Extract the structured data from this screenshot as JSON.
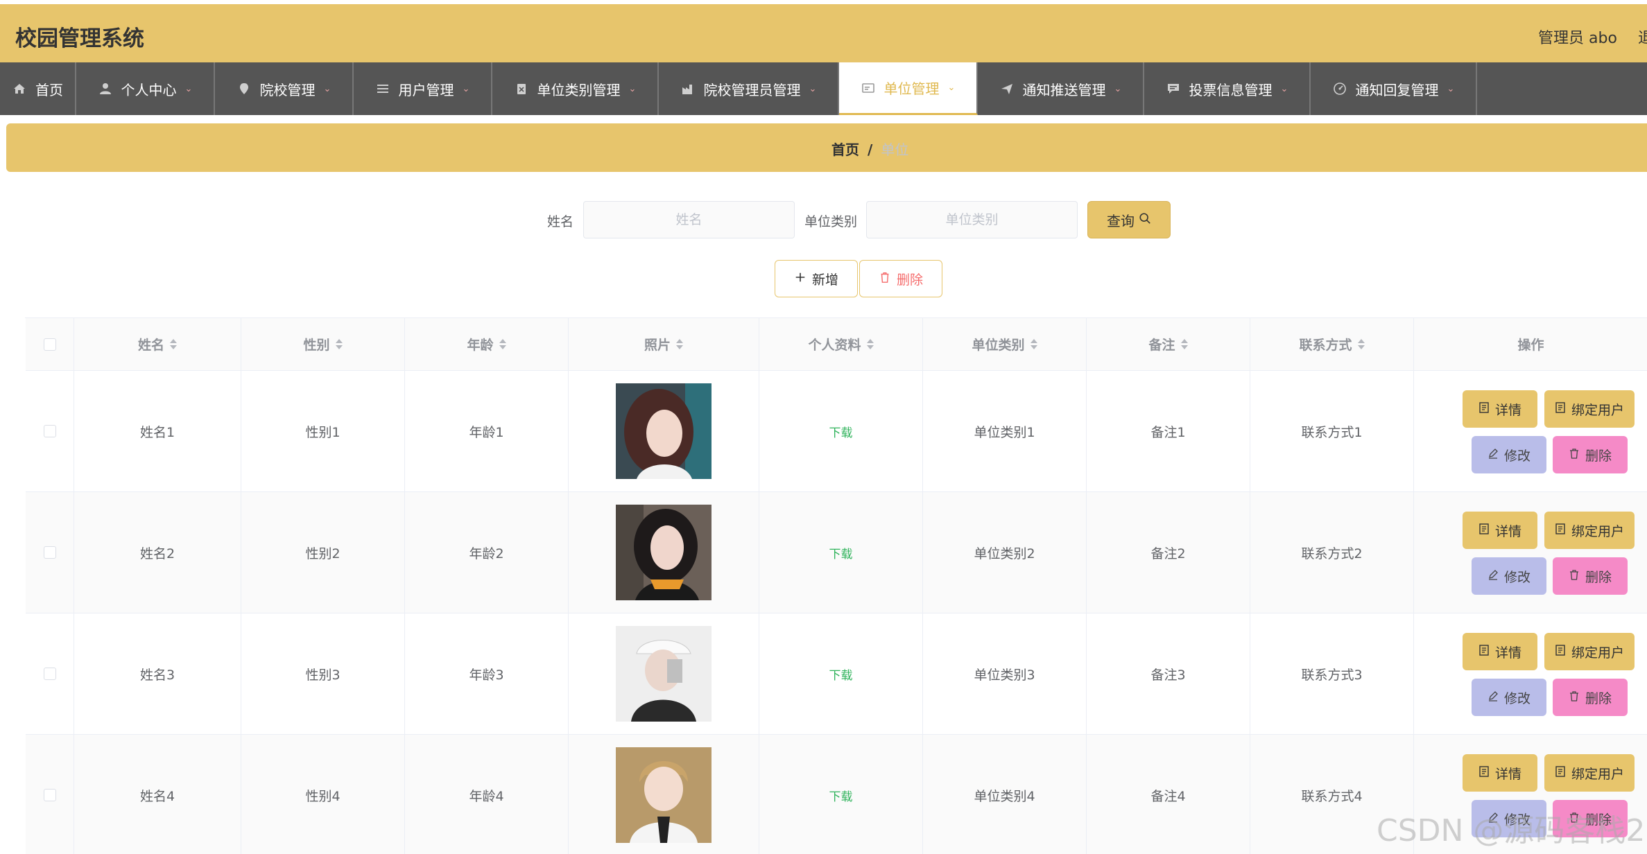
{
  "header": {
    "title": "校园管理系统",
    "user": "管理员 abo",
    "logout": "退"
  },
  "nav": [
    {
      "label": "首页",
      "icon": "home-icon",
      "chev": false
    },
    {
      "label": "个人中心",
      "icon": "user-icon",
      "chev": true
    },
    {
      "label": "院校管理",
      "icon": "pin-icon",
      "chev": true
    },
    {
      "label": "用户管理",
      "icon": "list-icon",
      "chev": true
    },
    {
      "label": "单位类别管理",
      "icon": "clipboard-icon",
      "chev": true
    },
    {
      "label": "院校管理员管理",
      "icon": "factory-icon",
      "chev": true
    },
    {
      "label": "单位管理",
      "icon": "card-icon",
      "chev": true,
      "active": true
    },
    {
      "label": "通知推送管理",
      "icon": "send-icon",
      "chev": true
    },
    {
      "label": "投票信息管理",
      "icon": "chat-icon",
      "chev": true
    },
    {
      "label": "通知回复管理",
      "icon": "dashboard-icon",
      "chev": true
    }
  ],
  "breadcrumb": {
    "home": "首页",
    "sep": "/",
    "current": "单位"
  },
  "search": {
    "name_label": "姓名",
    "name_placeholder": "姓名",
    "type_label": "单位类别",
    "type_placeholder": "单位类别",
    "query_label": "查询"
  },
  "toolbar": {
    "add_label": "新增",
    "delete_label": "删除"
  },
  "table": {
    "columns": [
      "姓名",
      "性别",
      "年龄",
      "照片",
      "个人资料",
      "单位类别",
      "备注",
      "联系方式",
      "操作"
    ],
    "rows": [
      {
        "name": "姓名1",
        "gender": "性别1",
        "age": "年龄1",
        "profile": "下载",
        "type": "单位类别1",
        "note": "备注1",
        "contact": "联系方式1"
      },
      {
        "name": "姓名2",
        "gender": "性别2",
        "age": "年龄2",
        "profile": "下载",
        "type": "单位类别2",
        "note": "备注2",
        "contact": "联系方式2"
      },
      {
        "name": "姓名3",
        "gender": "性别3",
        "age": "年龄3",
        "profile": "下载",
        "type": "单位类别3",
        "note": "备注3",
        "contact": "联系方式3"
      },
      {
        "name": "姓名4",
        "gender": "性别4",
        "age": "年龄4",
        "profile": "下载",
        "type": "单位类别4",
        "note": "备注4",
        "contact": "联系方式4"
      }
    ],
    "actions": {
      "detail": "详情",
      "bind": "绑定用户",
      "edit": "修改",
      "delete": "删除"
    }
  },
  "watermark": "CSDN @源码客栈2",
  "colors": {
    "accent": "#e7c56c",
    "nav": "#555555",
    "edit": "#b9bde9",
    "danger": "#f58ac7"
  }
}
